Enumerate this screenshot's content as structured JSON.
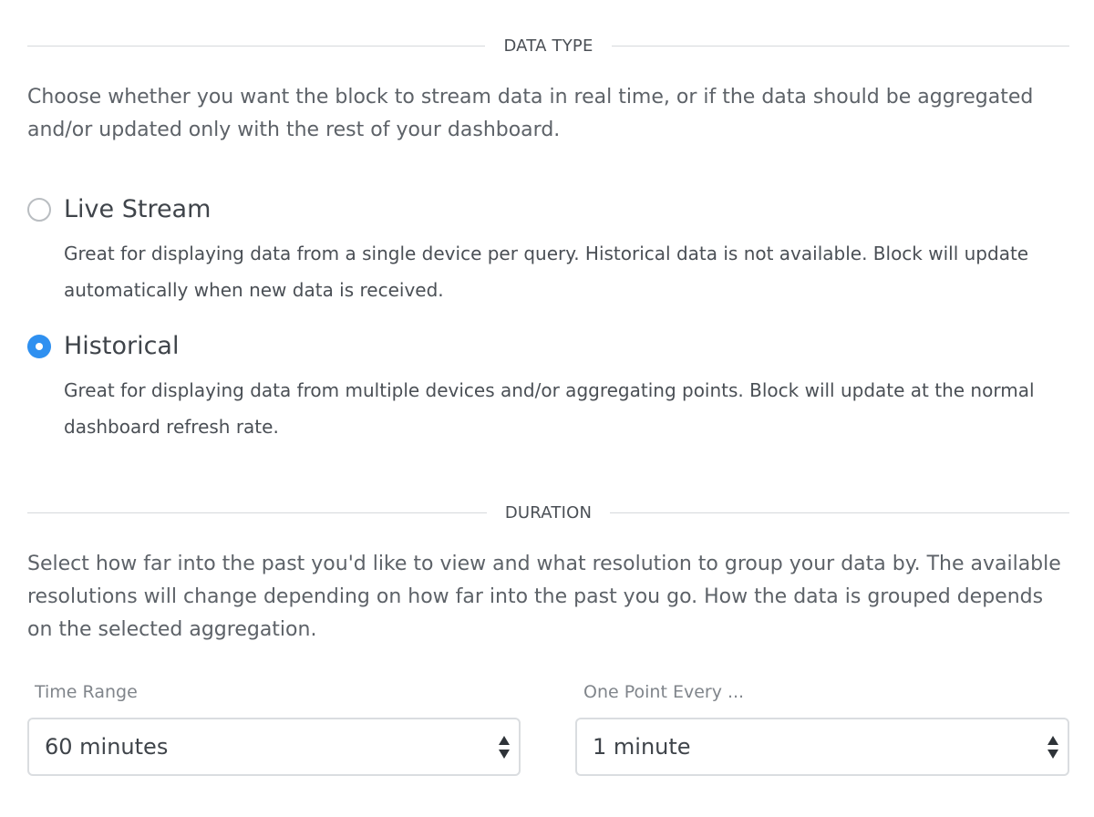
{
  "data_type": {
    "title": "DATA TYPE",
    "description": "Choose whether you want the block to stream data in real time, or if the data should be aggregated and/or updated only with the rest of your dashboard.",
    "options": [
      {
        "label": "Live Stream",
        "description": "Great for displaying data from a single device per query. Historical data is not available. Block will update automatically when new data is received.",
        "selected": false
      },
      {
        "label": "Historical",
        "description": "Great for displaying data from multiple devices and/or aggregating points. Block will update at the normal dashboard refresh rate.",
        "selected": true
      }
    ]
  },
  "duration": {
    "title": "DURATION",
    "description": "Select how far into the past you'd like to view and what resolution to group your data by. The available resolutions will change depending on how far into the past you go. How the data is grouped depends on the selected aggregation.",
    "time_range": {
      "label": "Time Range",
      "value": "60 minutes"
    },
    "resolution": {
      "label": "One Point Every ...",
      "value": "1 minute"
    }
  },
  "colors": {
    "accent": "#2f90f0",
    "text": "#4a4f55",
    "muted": "#80858b",
    "border": "#dadde0"
  },
  "icons": {
    "select_arrows": "up-down-caret-icon",
    "radio_selected": "radio-checked-icon",
    "radio_unselected": "radio-unchecked-icon"
  }
}
